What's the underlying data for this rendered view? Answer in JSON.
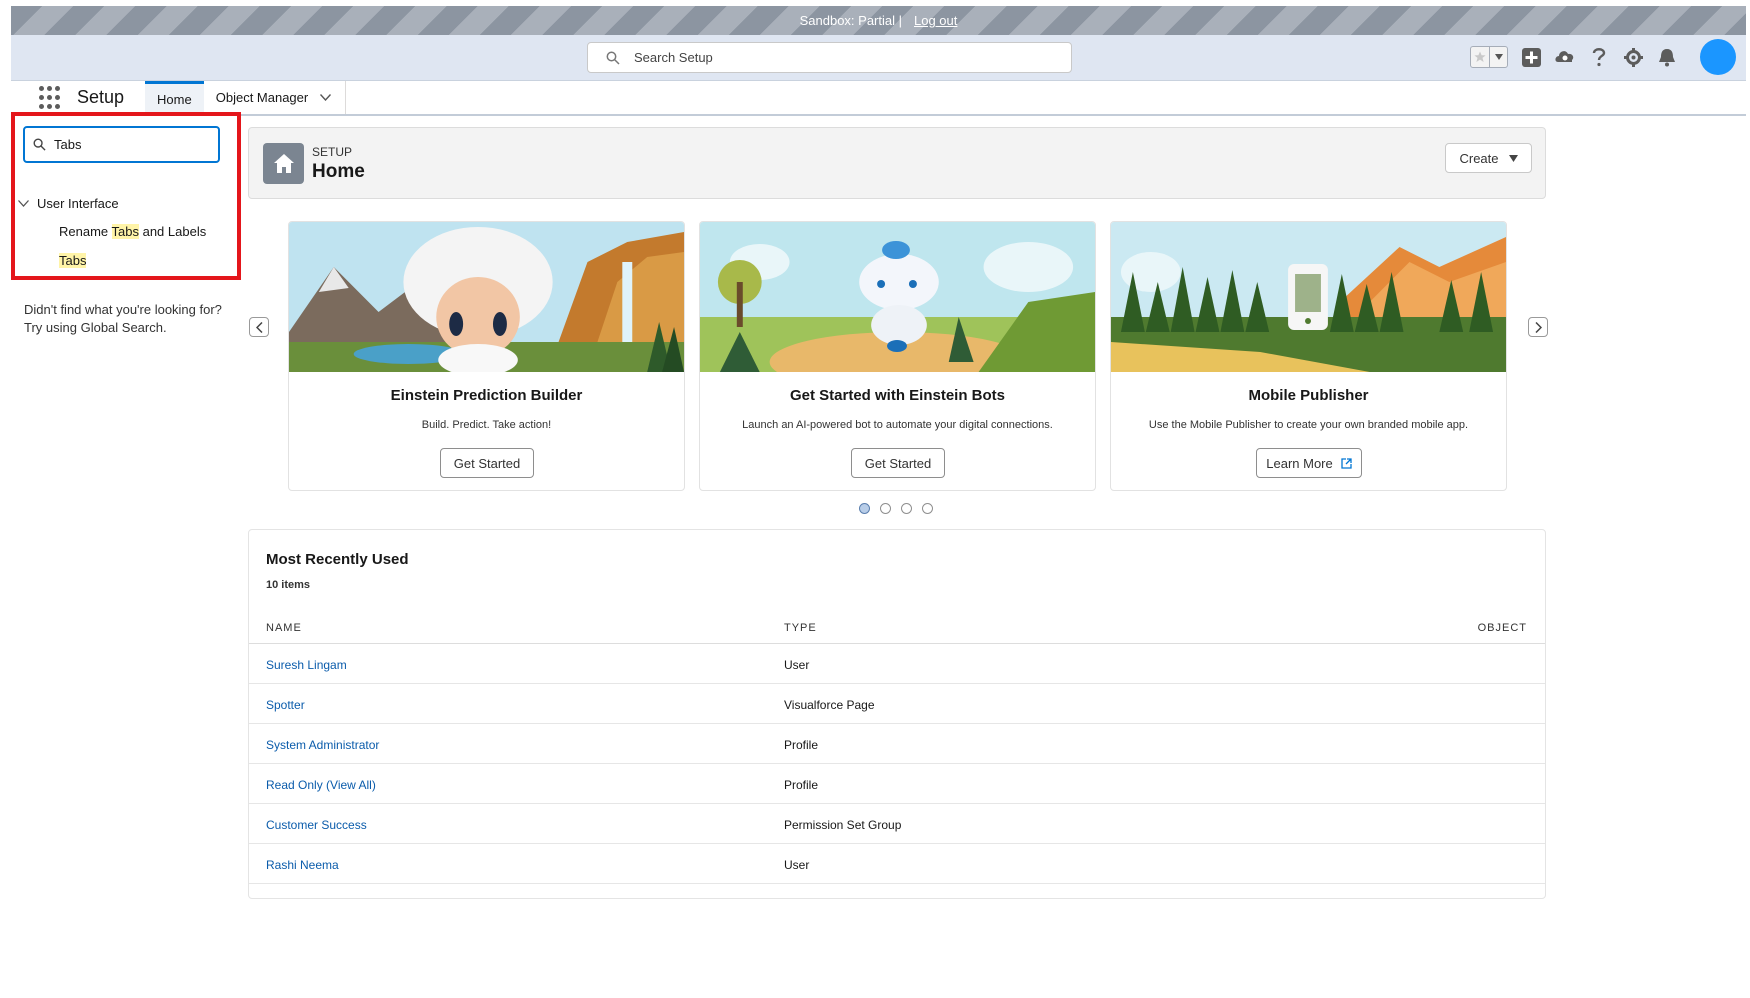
{
  "banner": {
    "text": "Sandbox: Partial |",
    "logout": "Log out"
  },
  "global_header": {
    "search_placeholder": "Search Setup"
  },
  "context_bar": {
    "app_name": "Setup",
    "tabs": [
      {
        "label": "Home"
      },
      {
        "label": "Object Manager"
      }
    ]
  },
  "quick_find": {
    "value": "Tabs",
    "parent": "User Interface",
    "results": [
      {
        "pre": "Rename ",
        "hl": "Tabs",
        "post": " and Labels"
      },
      {
        "pre": "",
        "hl": "Tabs",
        "post": ""
      }
    ],
    "not_found_line1": "Didn't find what you're looking for?",
    "not_found_line2": "Try using Global Search."
  },
  "page_header": {
    "small": "SETUP",
    "title": "Home",
    "create_label": "Create"
  },
  "carousel": {
    "cards": [
      {
        "title": "Einstein Prediction Builder",
        "desc": "Build. Predict. Take action!",
        "button": "Get Started"
      },
      {
        "title": "Get Started with Einstein Bots",
        "desc": "Launch an AI-powered bot to automate your digital connections.",
        "button": "Get Started"
      },
      {
        "title": "Mobile Publisher",
        "desc": "Use the Mobile Publisher to create your own branded mobile app.",
        "button": "Learn More"
      }
    ],
    "active_page": 1,
    "page_count": 4
  },
  "mru": {
    "title": "Most Recently Used",
    "count": "10 items",
    "columns": [
      "NAME",
      "TYPE",
      "OBJECT"
    ],
    "rows": [
      {
        "name": "Suresh Lingam",
        "type": "User"
      },
      {
        "name": "Spotter",
        "type": "Visualforce Page"
      },
      {
        "name": "System Administrator",
        "type": "Profile"
      },
      {
        "name": "Read Only (View All)",
        "type": "Profile"
      },
      {
        "name": "Customer Success",
        "type": "Permission Set Group"
      },
      {
        "name": "Rashi Neema",
        "type": "User"
      }
    ]
  },
  "colors": {
    "brand_blue": "#0176d3",
    "link": "#0b5cab",
    "highlight": "#fff4a8",
    "annotation_red": "#e4161b"
  }
}
